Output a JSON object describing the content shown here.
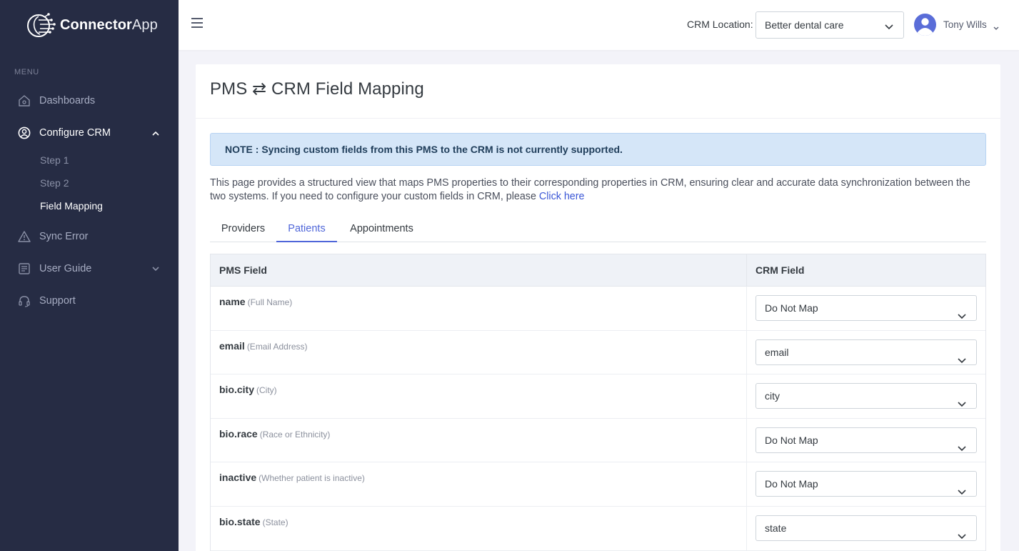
{
  "app": {
    "name_bold": "Connector",
    "name_light": "App"
  },
  "sidebar": {
    "menu_title": "MENU",
    "items": [
      {
        "label": "Dashboards",
        "icon": "home-icon"
      },
      {
        "label": "Configure CRM",
        "icon": "user-circle-icon",
        "expanded": true,
        "children": [
          {
            "label": "Step 1"
          },
          {
            "label": "Step 2"
          },
          {
            "label": "Field Mapping",
            "active": true
          }
        ]
      },
      {
        "label": "Sync Error",
        "icon": "warning-icon"
      },
      {
        "label": "User Guide",
        "icon": "document-icon",
        "expanded": false
      },
      {
        "label": "Support",
        "icon": "headset-icon"
      }
    ]
  },
  "topbar": {
    "location_label": "CRM Location:",
    "location_value": "Better dental care",
    "user_name": "Tony Wills"
  },
  "page": {
    "title": "PMS ⇄ CRM Field Mapping",
    "note": "NOTE : Syncing custom fields from this PMS to the CRM is not currently supported.",
    "description": "This page provides a structured view that maps PMS properties to their corresponding properties in CRM, ensuring clear and accurate data synchronization between the two systems. If you need to configure your custom fields in CRM, please",
    "link_text": "Click here",
    "tabs": [
      {
        "label": "Providers"
      },
      {
        "label": "Patients",
        "active": true
      },
      {
        "label": "Appointments"
      }
    ]
  },
  "table": {
    "headers": [
      "PMS Field",
      "CRM Field"
    ],
    "rows": [
      {
        "field": "name",
        "desc": "(Full Name)",
        "mapping": "Do Not Map"
      },
      {
        "field": "email",
        "desc": "(Email Address)",
        "mapping": "email"
      },
      {
        "field": "bio.city",
        "desc": "(City)",
        "mapping": "city"
      },
      {
        "field": "bio.race",
        "desc": "(Race or Ethnicity)",
        "mapping": "Do Not Map"
      },
      {
        "field": "inactive",
        "desc": "(Whether patient is inactive)",
        "mapping": "Do Not Map"
      },
      {
        "field": "bio.state",
        "desc": "(State)",
        "mapping": "state"
      }
    ]
  },
  "colors": {
    "sidebar_bg": "#262c44",
    "accent": "#4f66d9",
    "note_bg": "#d5e6f8"
  }
}
